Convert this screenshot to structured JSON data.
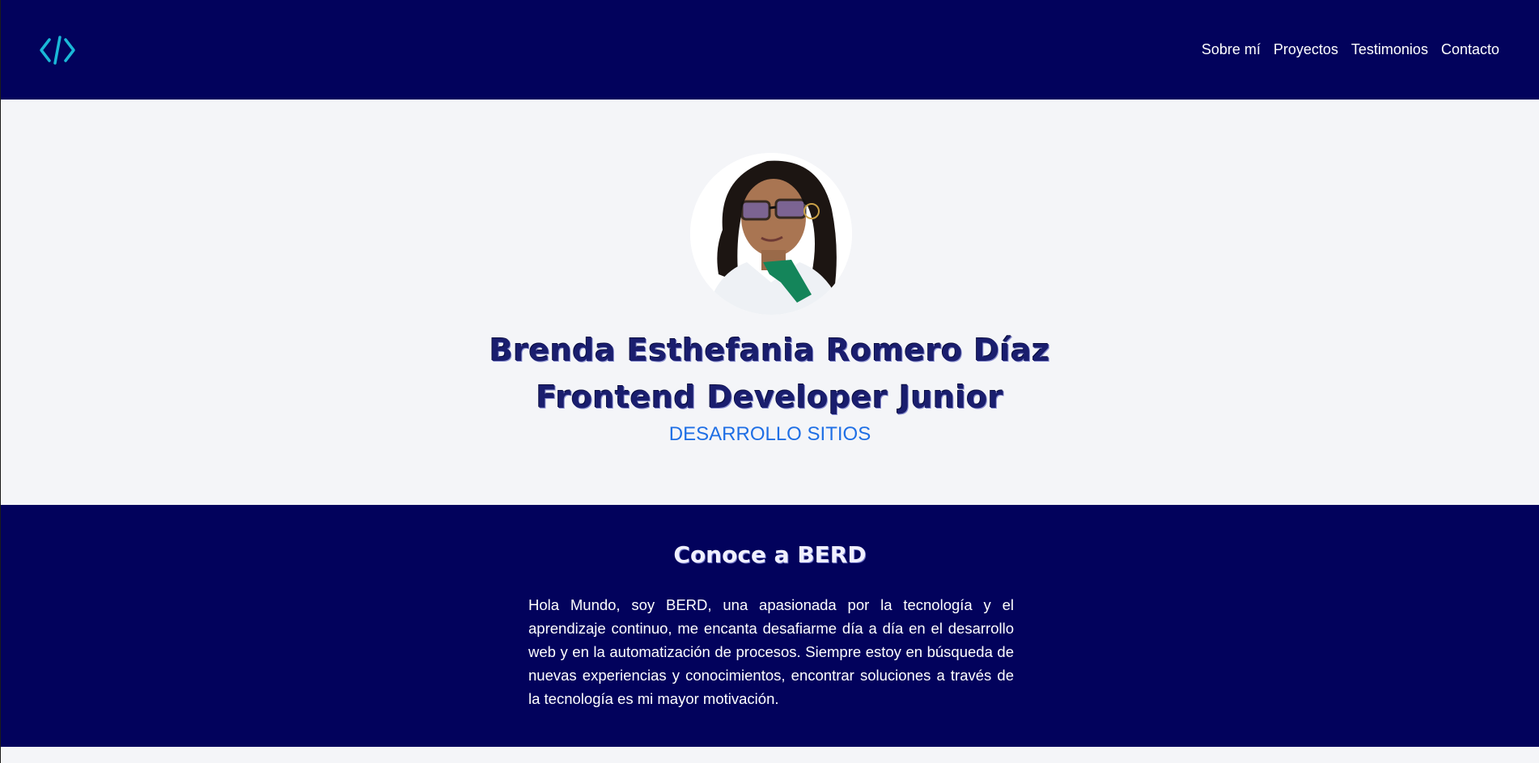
{
  "header": {
    "logo_icon": "code-brackets-icon",
    "nav": [
      {
        "label": "Sobre mí"
      },
      {
        "label": "Proyectos"
      },
      {
        "label": "Testimonios"
      },
      {
        "label": "Contacto"
      }
    ]
  },
  "hero": {
    "name": "Brenda Esthefania Romero Díaz",
    "role": "Frontend Developer Junior",
    "subtitle": "DESARROLLO SITIOS"
  },
  "about": {
    "title": "Conoce a BERD",
    "text": "Hola Mundo, soy BERD, una apasionada por la tecnología y el aprendizaje continuo, me encanta desafiarme día a día en el desarrollo web y en la automatización de procesos. Siempre estoy en búsqueda de nuevas experiencias y conocimientos, encontrar soluciones a través de la tecnología es mi mayor motivación."
  },
  "colors": {
    "header_bg": "#02025c",
    "hero_bg": "#f4f5f8",
    "accent_blue": "#1f6fe5",
    "logo_cyan": "#1ab8d8"
  }
}
